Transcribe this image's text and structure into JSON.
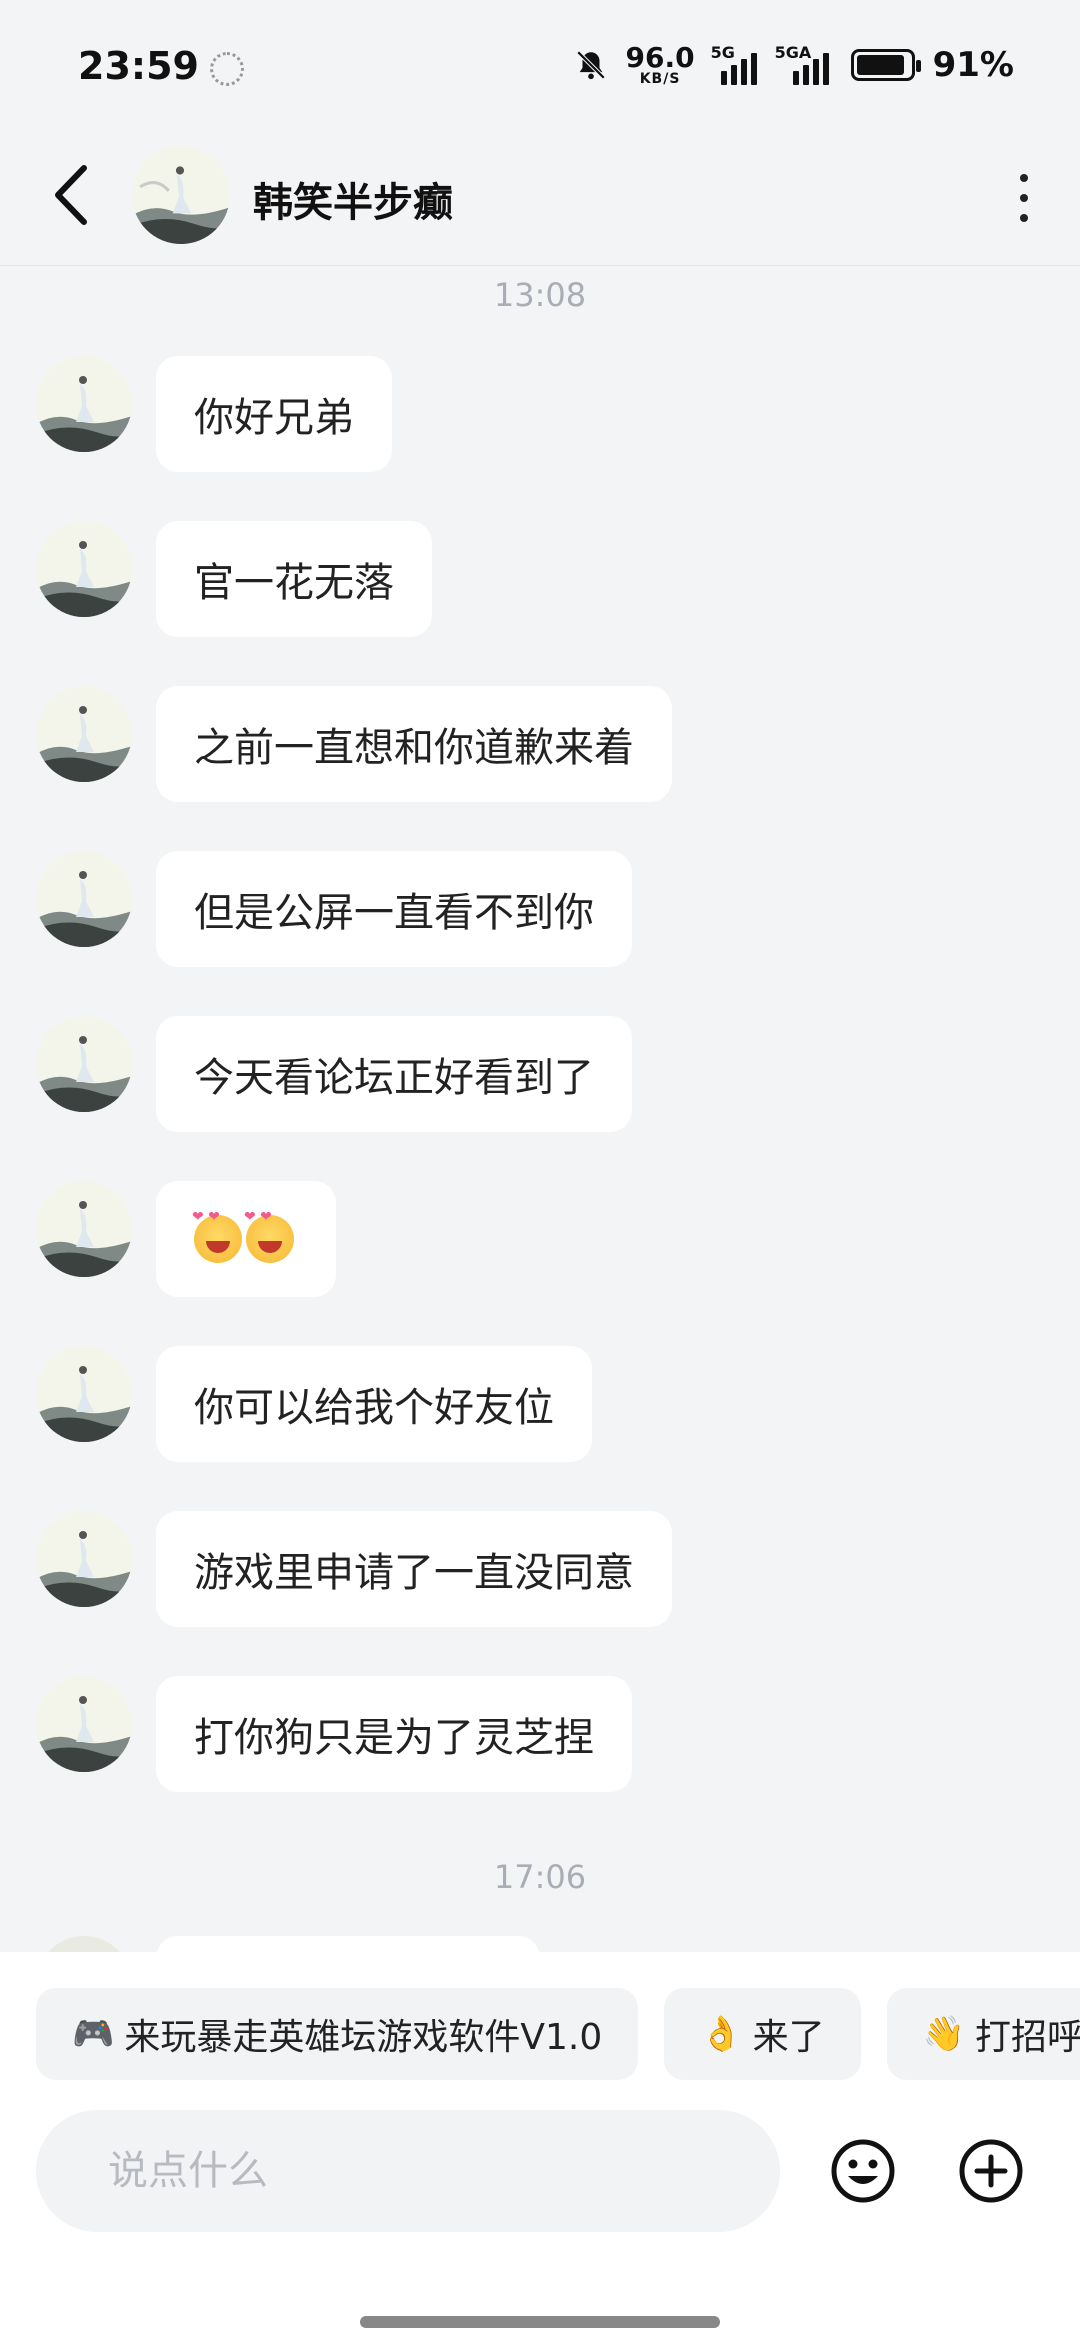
{
  "status": {
    "time": "23:59",
    "speed_value": "96.0",
    "speed_unit": "KB/S",
    "signal1_tag": "5G",
    "signal2_tag": "5GA",
    "battery": "91%",
    "battery_level": 0.91
  },
  "header": {
    "contact_name": "韩笑半步癫"
  },
  "chat": {
    "time1": "13:08",
    "messages": [
      "你好兄弟",
      "官一花无落",
      "之前一直想和你道歉来着",
      "但是公屏一直看不到你",
      "今天看论坛正好看到了",
      "",
      "你可以给我个好友位",
      "游戏里申请了一直没同意",
      "打你狗只是为了灵芝捏"
    ],
    "time2": "17:06"
  },
  "quick_replies": [
    {
      "icon": "🎮",
      "label": "来玩暴走英雄坛游戏软件V1.0"
    },
    {
      "icon": "👌",
      "label": "来了"
    },
    {
      "icon": "👋",
      "label": "打招呼"
    }
  ],
  "input": {
    "placeholder": "说点什么"
  }
}
